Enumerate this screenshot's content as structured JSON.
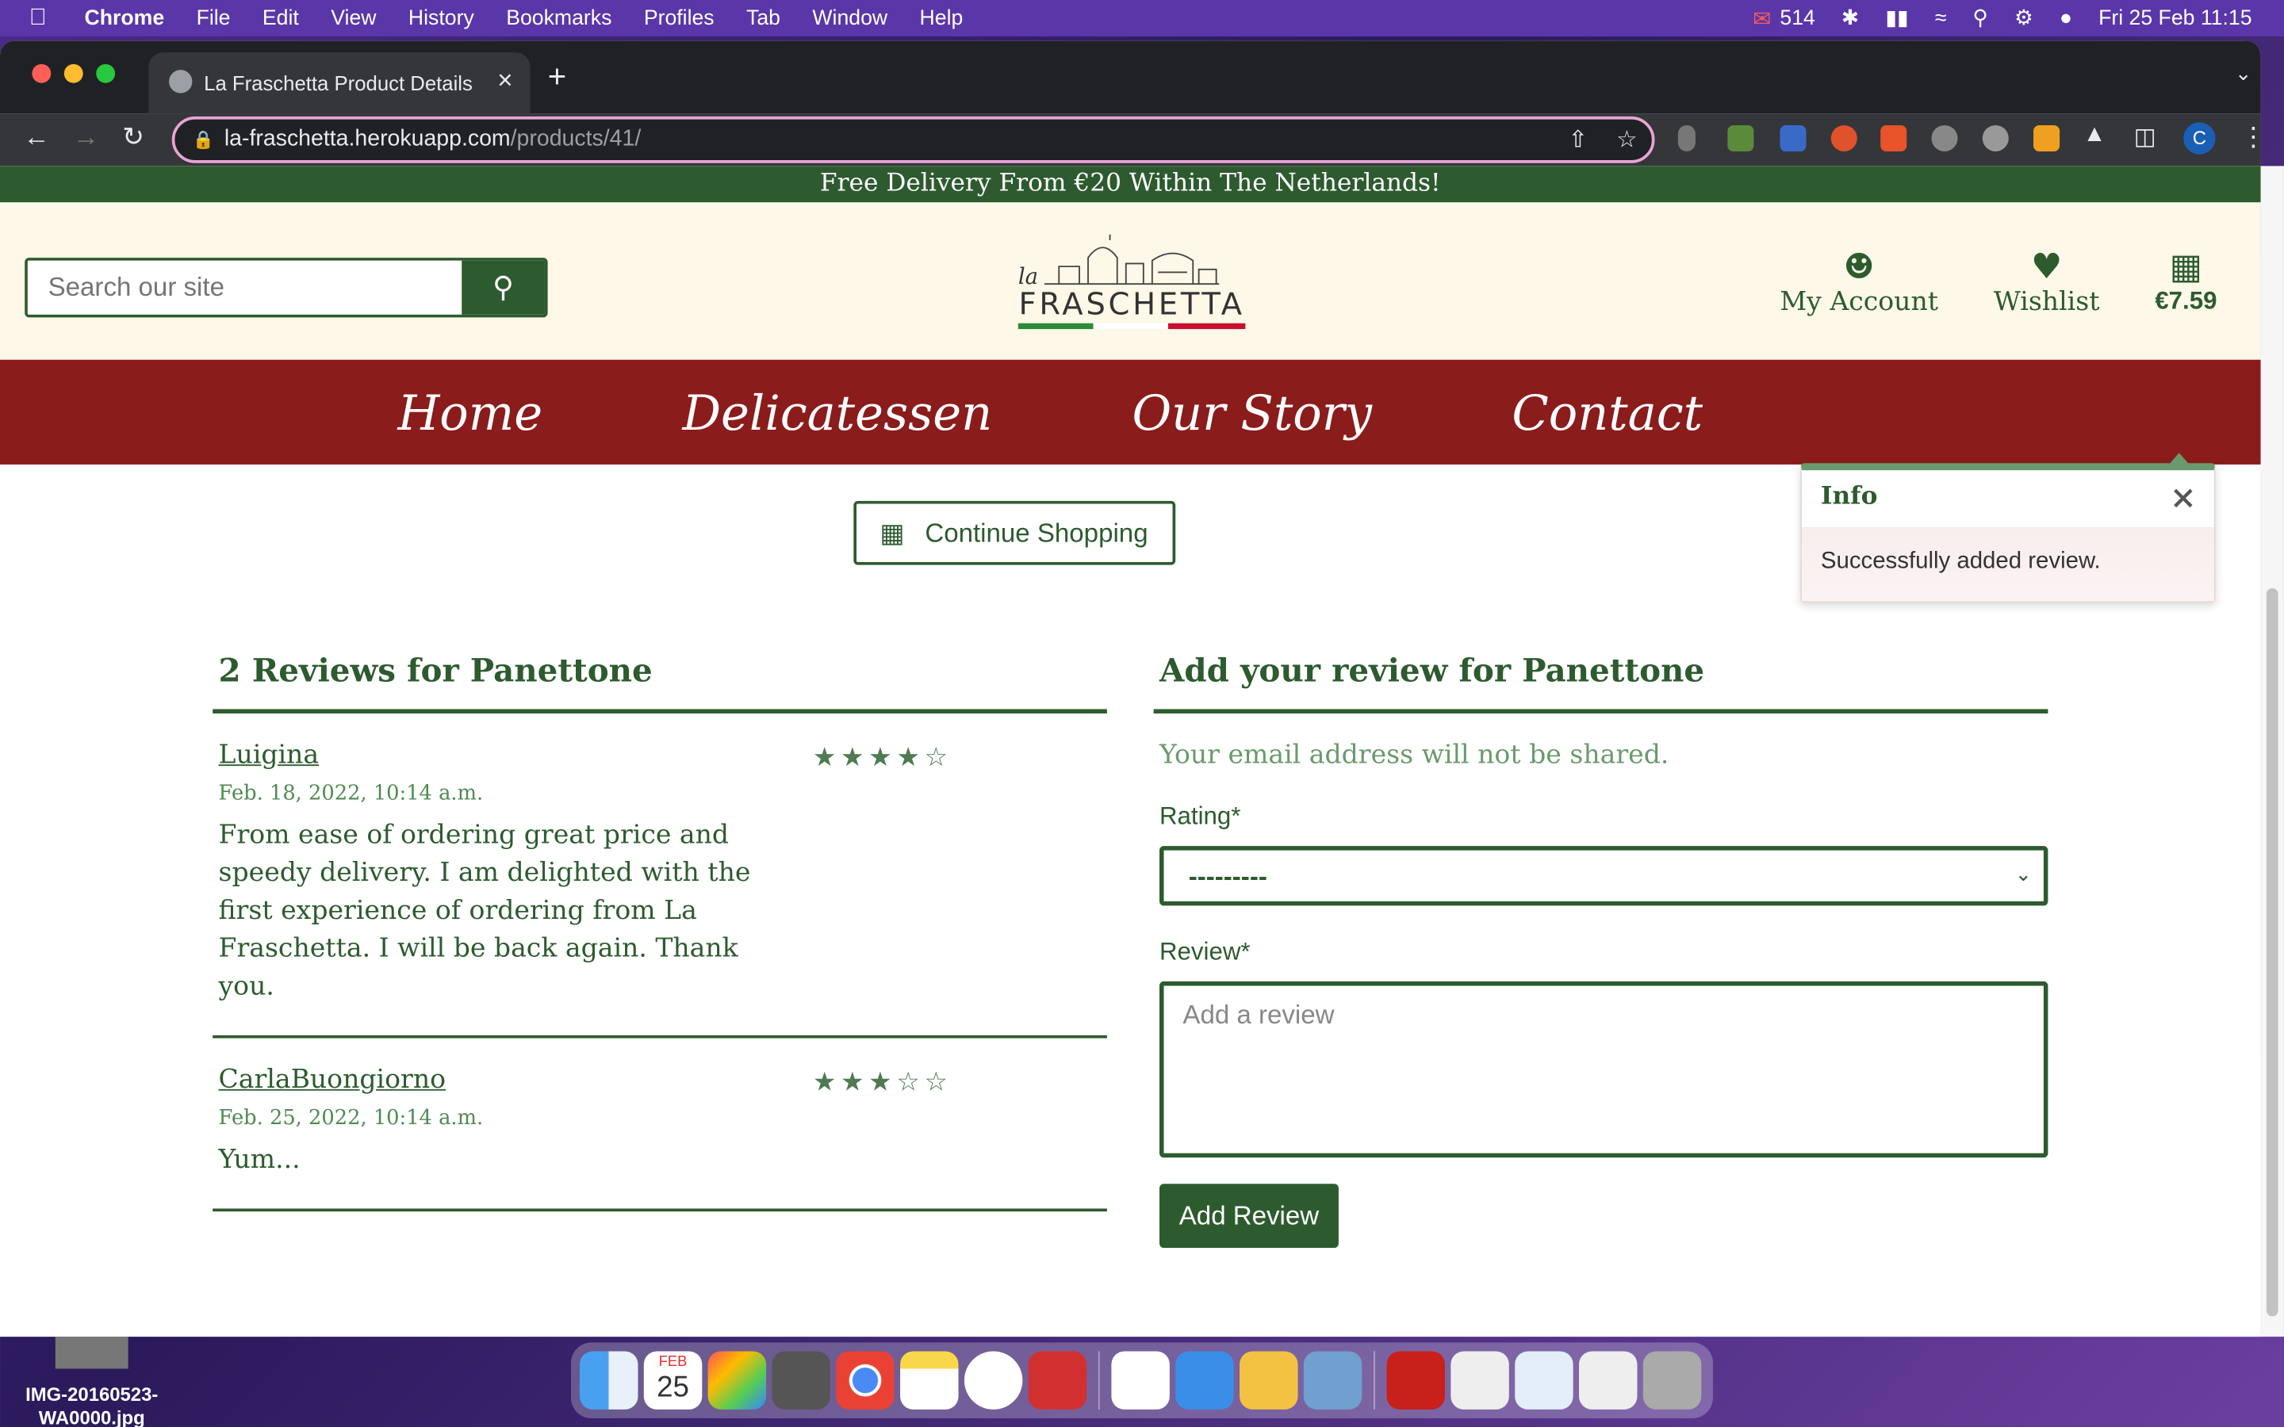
{
  "menubar": {
    "app": "Chrome",
    "items": [
      "File",
      "Edit",
      "View",
      "History",
      "Bookmarks",
      "Profiles",
      "Tab",
      "Window",
      "Help"
    ],
    "mail_count": "514",
    "datetime": "Fri 25 Feb  11:15"
  },
  "browser": {
    "tab_title": "La Fraschetta Product Details",
    "url_host": "la-fraschetta.herokuapp.com",
    "url_path": "/products/41/",
    "profile_initial": "C"
  },
  "site": {
    "banner": "Free Delivery From €20 Within The Netherlands!",
    "search_placeholder": "Search our site",
    "logo_small": "la",
    "logo_word": "FRASCHETTA",
    "account_label": "My Account",
    "wishlist_label": "Wishlist",
    "cart_total": "€7.59",
    "nav": [
      "Home",
      "Delicatessen",
      "Our Story",
      "Contact"
    ]
  },
  "toast": {
    "title": "Info",
    "message": "Successfully added review."
  },
  "continue_label": "Continue Shopping",
  "reviews": {
    "title": "2 Reviews for Panettone",
    "items": [
      {
        "name": "Luigina",
        "date": "Feb. 18, 2022, 10:14 a.m.",
        "rating": 4,
        "stars": "★★★★☆",
        "text": "From ease of ordering great price and speedy delivery. I am delighted with the first experience of ordering from La Fraschetta. I will be back again. Thank you."
      },
      {
        "name": "CarlaBuongiorno",
        "date": "Feb. 25, 2022, 10:14 a.m.",
        "rating": 3,
        "stars": "★★★☆☆",
        "text": "Yum..."
      }
    ]
  },
  "form": {
    "title": "Add your review for Panettone",
    "note": "Your email address will not be shared.",
    "rating_label": "Rating*",
    "rating_value": "---------",
    "review_label": "Review*",
    "review_placeholder": "Add a review",
    "submit_label": "Add Review"
  },
  "desktop": {
    "file_name": "IMG-20160523-WA0000.jpg"
  },
  "dock": {
    "calendar_month": "FEB",
    "calendar_day": "25"
  }
}
